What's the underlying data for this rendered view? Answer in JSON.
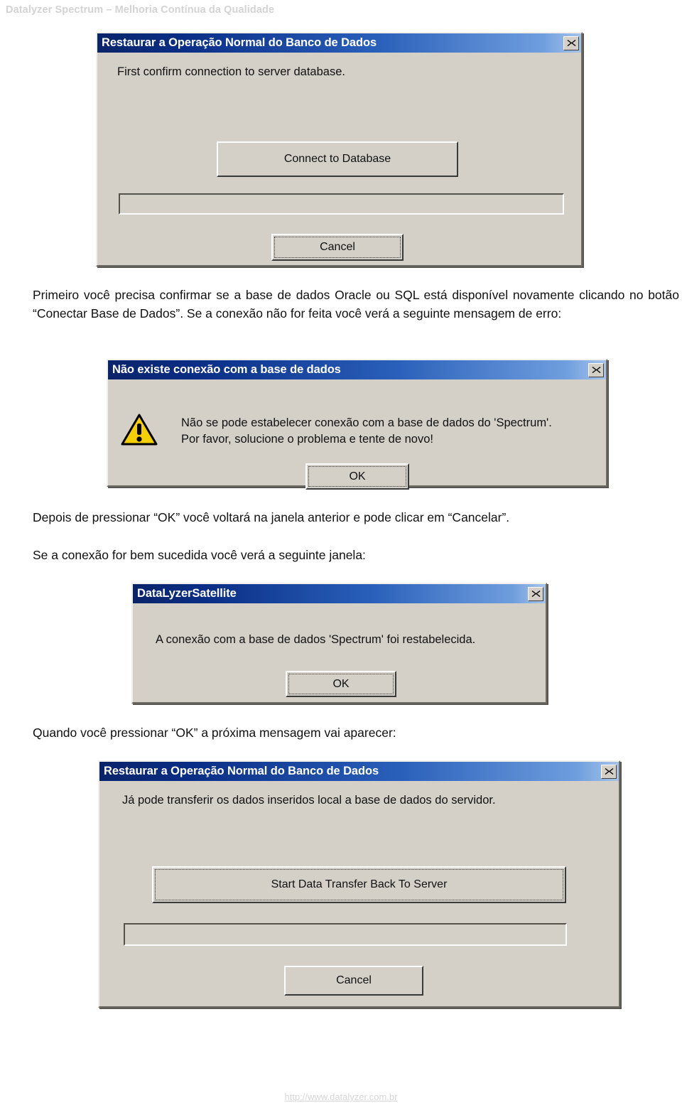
{
  "page": {
    "header": "Datalyzer Spectrum – Melhoria Contínua da Qualidade",
    "footer_url": "http://www.datalyzer.com.br"
  },
  "paragraphs": {
    "p1": "Primeiro você precisa confirmar se a base de dados Oracle ou SQL está disponível novamente clicando no botão “Conectar Base de Dados”. Se a conexão não for feita você verá a seguinte mensagem de erro:",
    "p2": "Depois de pressionar “OK” você voltará na janela anterior e pode clicar em “Cancelar”.",
    "p3": "Se a conexão for bem sucedida você verá a seguinte janela:",
    "p4": "Quando você pressionar “OK” a próxima mensagem vai aparecer:"
  },
  "dialog1": {
    "title": "Restaurar a Operação Normal do Banco de Dados",
    "close_label": "x",
    "message": "First confirm connection to server database.",
    "primary_button": "Connect to Database",
    "status_value": "",
    "cancel_button": "Cancel"
  },
  "dialog2": {
    "title": "Não existe conexão com a base de dados",
    "close_label": "x",
    "icon": "warning-triangle-icon",
    "message_line1": "Não se pode estabelecer conexão com a base de dados do 'Spectrum'.",
    "message_line2": "Por favor, solucione o problema e tente de novo!",
    "ok_button": "OK"
  },
  "dialog3": {
    "title": "DataLyzerSatellite",
    "close_label": "x",
    "message": "A conexão com a base de dados  'Spectrum' foi restabelecida.",
    "ok_button": "OK"
  },
  "dialog4": {
    "title": "Restaurar a Operação Normal do Banco de Dados",
    "close_label": "x",
    "message": "Já pode transferir os dados inseridos local a base de dados do servidor.",
    "primary_button": "Start Data Transfer Back To Server",
    "status_value": "",
    "cancel_button": "Cancel"
  },
  "colors": {
    "titlebar_start": "#0a246a",
    "titlebar_end": "#a6c4ea",
    "dialog_face": "#d4d0c8",
    "warning_yellow": "#f5d000",
    "header_gray": "#d3d3d3"
  }
}
